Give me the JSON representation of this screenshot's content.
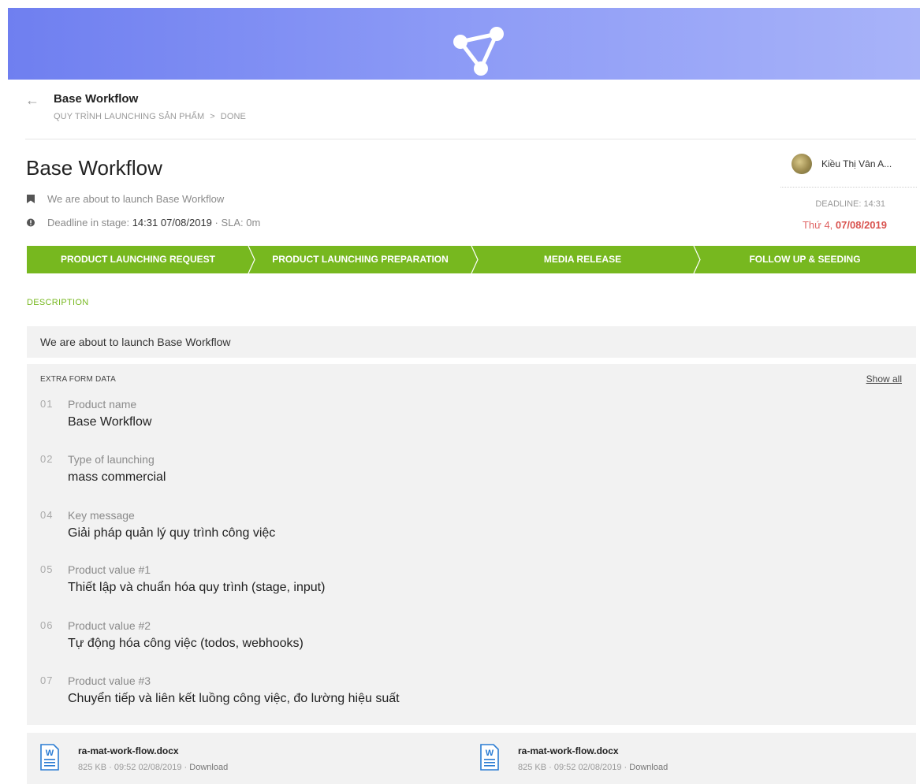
{
  "header": {
    "title": "Base Workflow",
    "breadcrumb": [
      "QUY TRÌNH LAUNCHING SẢN PHẨM",
      "DONE"
    ],
    "breadcrumb_sep": ">"
  },
  "task": {
    "title": "Base Workflow",
    "subtitle": "We are about to launch Base Workflow",
    "deadline_prefix": "Deadline in stage:",
    "deadline_value": "14:31 07/08/2019",
    "sla": "· SLA: 0m"
  },
  "assignee": {
    "name": "Kiều Thị Vân A...",
    "deadline_label": "DEADLINE: 14:31",
    "deadline_day": "Thứ 4,",
    "deadline_date": "07/08/2019"
  },
  "stages": [
    {
      "label": "PRODUCT LAUNCHING REQUEST"
    },
    {
      "label": "PRODUCT LAUNCHING PREPARATION"
    },
    {
      "label": "MEDIA RELEASE"
    },
    {
      "label": "FOLLOW UP & SEEDING"
    }
  ],
  "description": {
    "section_label": "DESCRIPTION",
    "text": "We are about to launch Base Workflow"
  },
  "extra_form": {
    "label": "EXTRA FORM DATA",
    "show_all": "Show all",
    "fields": [
      {
        "num": "01",
        "label": "Product name",
        "value": "Base Workflow"
      },
      {
        "num": "02",
        "label": "Type of launching",
        "value": "mass commercial"
      },
      {
        "num": "04",
        "label": "Key message",
        "value": "Giải pháp quản lý quy trình công việc"
      },
      {
        "num": "05",
        "label": "Product value #1",
        "value": "Thiết lập và chuẩn hóa quy trình (stage, input)"
      },
      {
        "num": "06",
        "label": "Product value #2",
        "value": "Tự động hóa công việc (todos, webhooks)"
      },
      {
        "num": "07",
        "label": "Product value #3",
        "value": "Chuyển tiếp và liên kết luồng công việc, đo lường hiệu suất"
      }
    ]
  },
  "attachments": [
    {
      "name": "ra-mat-work-flow.docx",
      "meta": "825 KB · 09:52 02/08/2019 ·",
      "action": "Download",
      "icon_letter": "W"
    },
    {
      "name": "ra-mat-work-flow.docx",
      "meta": "825 KB · 09:52 02/08/2019 ·",
      "action": "Download",
      "icon_letter": "W"
    }
  ],
  "colors": {
    "accent_green": "#77b81f",
    "deadline_red": "#d9534f",
    "banner_start": "#6f7ff0",
    "banner_end": "#a8b3f9"
  },
  "icons": {
    "banner": "workflow-nodes-icon",
    "back": "arrow-left-icon",
    "subtitle": "bookmark-icon",
    "deadline": "alert-circle-icon",
    "file": "word-document-icon"
  }
}
